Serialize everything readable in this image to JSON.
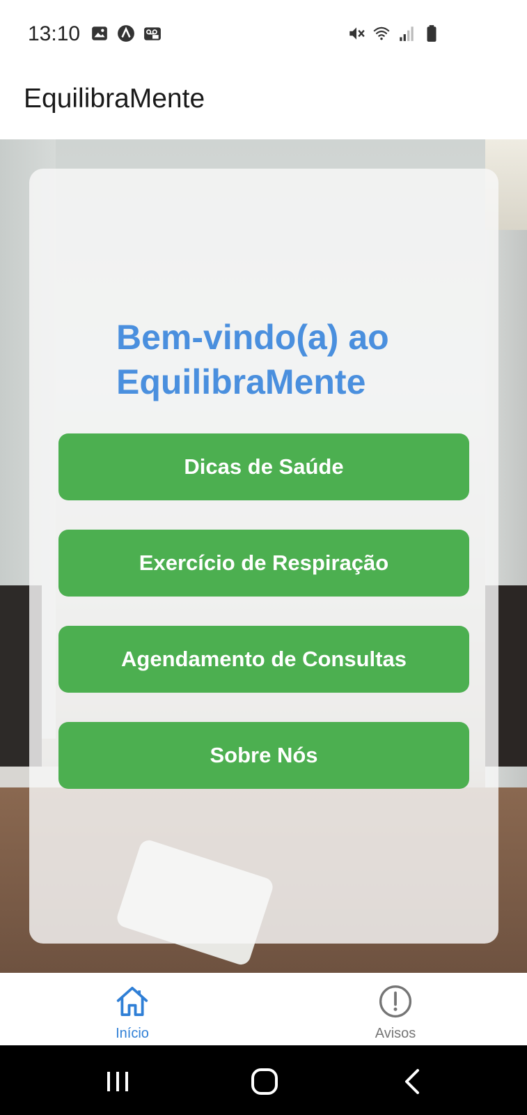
{
  "status_bar": {
    "time": "13:10",
    "left_icons": [
      "image-icon",
      "app-logo-icon",
      "voicemail-icon"
    ],
    "right_icons": [
      "mute-icon",
      "wifi-icon",
      "signal-icon",
      "battery-icon"
    ]
  },
  "app_bar": {
    "title": "EquilibraMente"
  },
  "main": {
    "welcome": "Bem-vindo(a) ao EquilibraMente",
    "buttons": [
      {
        "label": "Dicas de Saúde"
      },
      {
        "label": "Exercício de Respiração"
      },
      {
        "label": "Agendamento de Consultas"
      },
      {
        "label": "Sobre Nós"
      }
    ]
  },
  "bottom_nav": {
    "items": [
      {
        "label": "Início",
        "icon": "home-icon",
        "active": true
      },
      {
        "label": "Avisos",
        "icon": "alert-circle-icon",
        "active": false
      }
    ]
  },
  "colors": {
    "accent": "#4a8fde",
    "button": "#4caf50",
    "nav_active": "#2f7fd6",
    "nav_inactive": "#757575"
  }
}
